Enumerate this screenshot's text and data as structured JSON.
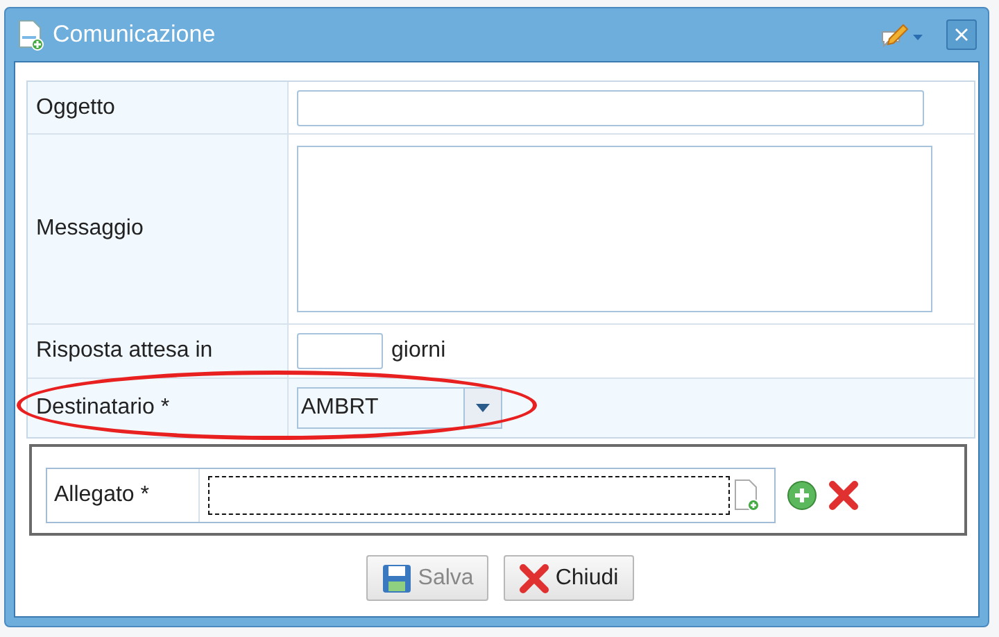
{
  "window": {
    "title": "Comunicazione"
  },
  "form": {
    "rows": [
      {
        "kind": "text",
        "label": "Oggetto",
        "highlighted": false
      },
      {
        "kind": "textarea",
        "label": "Messaggio",
        "highlighted": false
      },
      {
        "kind": "short",
        "label": "Risposta attesa in",
        "suffix": "giorni",
        "highlighted": false
      },
      {
        "kind": "combo",
        "label": "Destinatario *",
        "value": "AMBRT",
        "highlighted": true
      }
    ]
  },
  "attachment": {
    "label": "Allegato *"
  },
  "buttons": [
    {
      "kind": "save",
      "label": "Salva",
      "disabled": true
    },
    {
      "kind": "close",
      "label": "Chiudi",
      "disabled": false
    }
  ]
}
